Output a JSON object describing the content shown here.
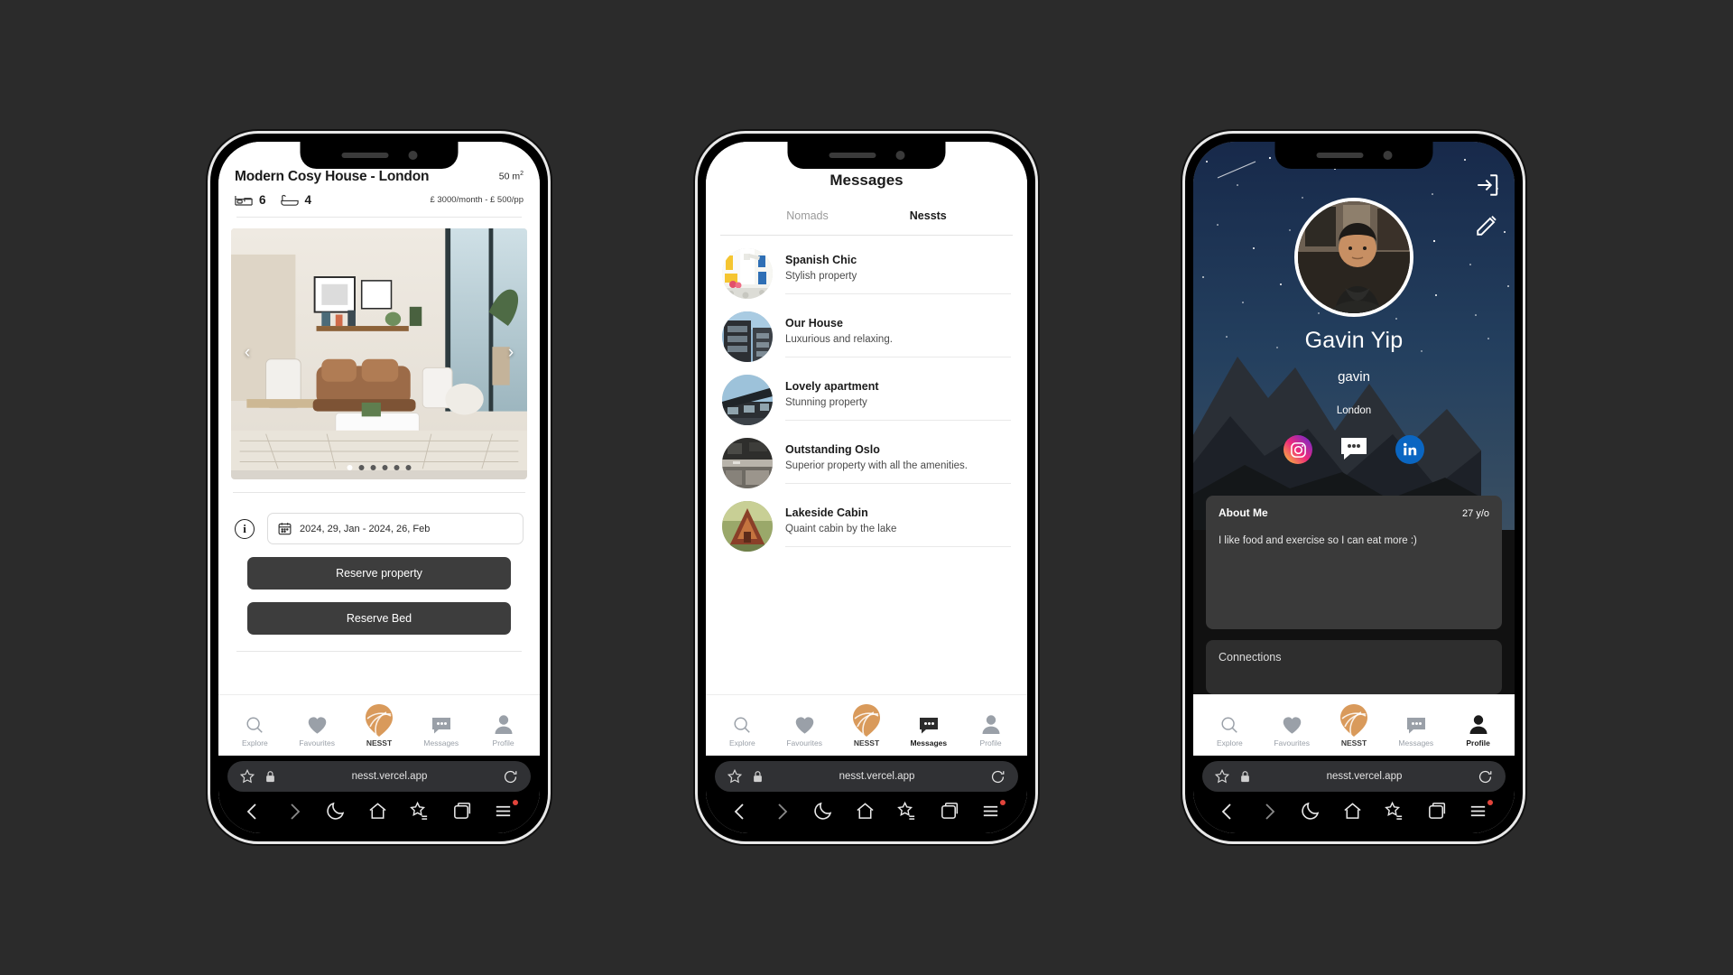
{
  "browser": {
    "url": "nesst.vercel.app",
    "star_icon": "star-icon",
    "lock_icon": "lock-icon",
    "reload_icon": "reload-icon",
    "back_icon": "back-arrow-icon",
    "forward_icon": "forward-arrow-icon",
    "dark_mode_icon": "moon-icon",
    "home_icon": "home-icon",
    "bookmarks_icon": "bookmarks-icon",
    "tabs_icon": "tabs-icon",
    "menu_icon": "menu-icon"
  },
  "nav": {
    "items": [
      {
        "label": "Explore",
        "icon": "search-icon"
      },
      {
        "label": "Favourites",
        "icon": "heart-icon"
      },
      {
        "label": "NESST",
        "icon": "nesst-logo-icon"
      },
      {
        "label": "Messages",
        "icon": "chat-bubble-icon"
      },
      {
        "label": "Profile",
        "icon": "person-icon"
      }
    ],
    "active_screen1": "",
    "active_screen2": "Messages",
    "active_screen3": "Profile"
  },
  "property": {
    "title": "Modern Cosy House - London",
    "area": "50 m",
    "area_sup": "2",
    "beds": "6",
    "baths": "4",
    "bed_icon": "bed-icon",
    "bath_icon": "bathtub-icon",
    "price": "£ 3000/month - £ 500/pp",
    "carousel": {
      "prev_icon": "chevron-left-icon",
      "next_icon": "chevron-right-icon",
      "dots": 6,
      "active_dot": 0
    },
    "info_icon": "info-icon",
    "calendar_icon": "calendar-icon",
    "date_range": "2024, 29, Jan - 2024, 26, Feb",
    "reserve_property_label": "Reserve property",
    "reserve_bed_label": "Reserve Bed"
  },
  "messages": {
    "title": "Messages",
    "tabs": [
      {
        "label": "Nomads",
        "active": false
      },
      {
        "label": "Nessts",
        "active": true
      }
    ],
    "list": [
      {
        "name": "Spanish Chic",
        "subtitle": "Stylish property",
        "thumb": "spanish-street-thumb"
      },
      {
        "name": "Our House",
        "subtitle": "Luxurious and relaxing.",
        "thumb": "modern-building-thumb"
      },
      {
        "name": "Lovely apartment",
        "subtitle": "Stunning property",
        "thumb": "apartment-thumb"
      },
      {
        "name": "Outstanding Oslo",
        "subtitle": "Superior property with all the amenities.",
        "thumb": "kitchen-thumb"
      },
      {
        "name": "Lakeside Cabin",
        "subtitle": "Quaint cabin by the lake",
        "thumb": "cabin-thumb"
      }
    ]
  },
  "profile": {
    "logout_icon": "logout-icon",
    "edit_icon": "edit-pencil-icon",
    "avatar": "user-avatar",
    "name": "Gavin Yip",
    "handle": "gavin",
    "location": "London",
    "socials": [
      {
        "name": "instagram-icon"
      },
      {
        "name": "chat-bubble-icon"
      },
      {
        "name": "linkedin-icon"
      }
    ],
    "about_title": "About Me",
    "age": "27 y/o",
    "about_body": "I like food and exercise so I can eat more :)",
    "connections_title": "Connections"
  },
  "colors": {
    "accent": "#d99a5b",
    "dark_button": "#3d3d3d",
    "panel": "#3a3a3a",
    "nav_inactive": "#9aa0a8",
    "linkedin": "#0a66c2"
  }
}
